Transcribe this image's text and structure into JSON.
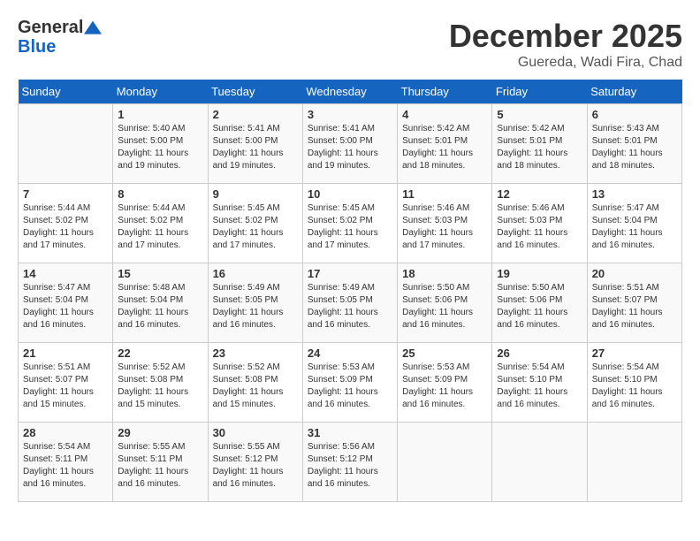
{
  "header": {
    "logo_line1": "General",
    "logo_line2": "Blue",
    "month": "December 2025",
    "location": "Guereda, Wadi Fira, Chad"
  },
  "weekdays": [
    "Sunday",
    "Monday",
    "Tuesday",
    "Wednesday",
    "Thursday",
    "Friday",
    "Saturday"
  ],
  "weeks": [
    [
      {
        "day": "",
        "sunrise": "",
        "sunset": "",
        "daylight": ""
      },
      {
        "day": "1",
        "sunrise": "5:40 AM",
        "sunset": "5:00 PM",
        "daylight": "11 hours and 19 minutes."
      },
      {
        "day": "2",
        "sunrise": "5:41 AM",
        "sunset": "5:00 PM",
        "daylight": "11 hours and 19 minutes."
      },
      {
        "day": "3",
        "sunrise": "5:41 AM",
        "sunset": "5:00 PM",
        "daylight": "11 hours and 19 minutes."
      },
      {
        "day": "4",
        "sunrise": "5:42 AM",
        "sunset": "5:01 PM",
        "daylight": "11 hours and 18 minutes."
      },
      {
        "day": "5",
        "sunrise": "5:42 AM",
        "sunset": "5:01 PM",
        "daylight": "11 hours and 18 minutes."
      },
      {
        "day": "6",
        "sunrise": "5:43 AM",
        "sunset": "5:01 PM",
        "daylight": "11 hours and 18 minutes."
      }
    ],
    [
      {
        "day": "7",
        "sunrise": "5:44 AM",
        "sunset": "5:02 PM",
        "daylight": "11 hours and 17 minutes."
      },
      {
        "day": "8",
        "sunrise": "5:44 AM",
        "sunset": "5:02 PM",
        "daylight": "11 hours and 17 minutes."
      },
      {
        "day": "9",
        "sunrise": "5:45 AM",
        "sunset": "5:02 PM",
        "daylight": "11 hours and 17 minutes."
      },
      {
        "day": "10",
        "sunrise": "5:45 AM",
        "sunset": "5:02 PM",
        "daylight": "11 hours and 17 minutes."
      },
      {
        "day": "11",
        "sunrise": "5:46 AM",
        "sunset": "5:03 PM",
        "daylight": "11 hours and 17 minutes."
      },
      {
        "day": "12",
        "sunrise": "5:46 AM",
        "sunset": "5:03 PM",
        "daylight": "11 hours and 16 minutes."
      },
      {
        "day": "13",
        "sunrise": "5:47 AM",
        "sunset": "5:04 PM",
        "daylight": "11 hours and 16 minutes."
      }
    ],
    [
      {
        "day": "14",
        "sunrise": "5:47 AM",
        "sunset": "5:04 PM",
        "daylight": "11 hours and 16 minutes."
      },
      {
        "day": "15",
        "sunrise": "5:48 AM",
        "sunset": "5:04 PM",
        "daylight": "11 hours and 16 minutes."
      },
      {
        "day": "16",
        "sunrise": "5:49 AM",
        "sunset": "5:05 PM",
        "daylight": "11 hours and 16 minutes."
      },
      {
        "day": "17",
        "sunrise": "5:49 AM",
        "sunset": "5:05 PM",
        "daylight": "11 hours and 16 minutes."
      },
      {
        "day": "18",
        "sunrise": "5:50 AM",
        "sunset": "5:06 PM",
        "daylight": "11 hours and 16 minutes."
      },
      {
        "day": "19",
        "sunrise": "5:50 AM",
        "sunset": "5:06 PM",
        "daylight": "11 hours and 16 minutes."
      },
      {
        "day": "20",
        "sunrise": "5:51 AM",
        "sunset": "5:07 PM",
        "daylight": "11 hours and 16 minutes."
      }
    ],
    [
      {
        "day": "21",
        "sunrise": "5:51 AM",
        "sunset": "5:07 PM",
        "daylight": "11 hours and 15 minutes."
      },
      {
        "day": "22",
        "sunrise": "5:52 AM",
        "sunset": "5:08 PM",
        "daylight": "11 hours and 15 minutes."
      },
      {
        "day": "23",
        "sunrise": "5:52 AM",
        "sunset": "5:08 PM",
        "daylight": "11 hours and 15 minutes."
      },
      {
        "day": "24",
        "sunrise": "5:53 AM",
        "sunset": "5:09 PM",
        "daylight": "11 hours and 16 minutes."
      },
      {
        "day": "25",
        "sunrise": "5:53 AM",
        "sunset": "5:09 PM",
        "daylight": "11 hours and 16 minutes."
      },
      {
        "day": "26",
        "sunrise": "5:54 AM",
        "sunset": "5:10 PM",
        "daylight": "11 hours and 16 minutes."
      },
      {
        "day": "27",
        "sunrise": "5:54 AM",
        "sunset": "5:10 PM",
        "daylight": "11 hours and 16 minutes."
      }
    ],
    [
      {
        "day": "28",
        "sunrise": "5:54 AM",
        "sunset": "5:11 PM",
        "daylight": "11 hours and 16 minutes."
      },
      {
        "day": "29",
        "sunrise": "5:55 AM",
        "sunset": "5:11 PM",
        "daylight": "11 hours and 16 minutes."
      },
      {
        "day": "30",
        "sunrise": "5:55 AM",
        "sunset": "5:12 PM",
        "daylight": "11 hours and 16 minutes."
      },
      {
        "day": "31",
        "sunrise": "5:56 AM",
        "sunset": "5:12 PM",
        "daylight": "11 hours and 16 minutes."
      },
      {
        "day": "",
        "sunrise": "",
        "sunset": "",
        "daylight": ""
      },
      {
        "day": "",
        "sunrise": "",
        "sunset": "",
        "daylight": ""
      },
      {
        "day": "",
        "sunrise": "",
        "sunset": "",
        "daylight": ""
      }
    ]
  ],
  "labels": {
    "sunrise": "Sunrise:",
    "sunset": "Sunset:",
    "daylight": "Daylight:"
  }
}
